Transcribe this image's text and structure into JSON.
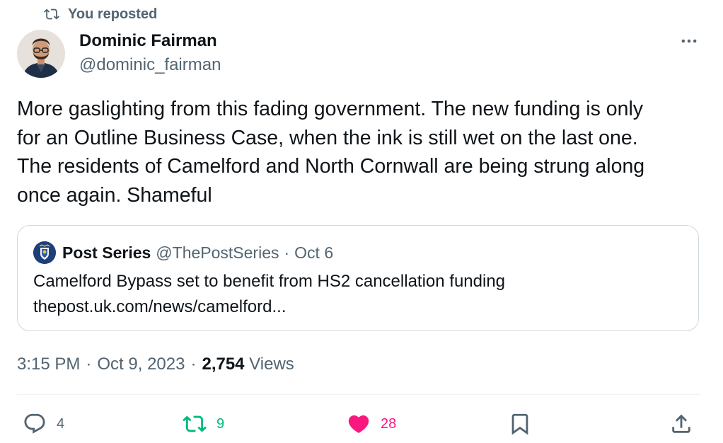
{
  "repost_banner": {
    "label": "You reposted"
  },
  "author": {
    "name": "Dominic Fairman",
    "handle": "@dominic_fairman"
  },
  "tweet": {
    "text": "More gaslighting from this fading government. The new funding is only\nfor an Outline Business Case, when the ink is still wet on the last one.\nThe residents of Camelford and North Cornwall are being strung along\nonce again. Shameful"
  },
  "quote": {
    "name": "Post Series",
    "handle": "@ThePostSeries",
    "separator": "·",
    "date": "Oct 6",
    "title": "Camelford Bypass set to benefit from HS2 cancellation funding",
    "link": "thepost.uk.com/news/camelford..."
  },
  "meta": {
    "time": "3:15 PM",
    "dot1": "·",
    "date": "Oct 9, 2023",
    "dot2": "·",
    "views_count": "2,754",
    "views_label": "Views"
  },
  "actions": {
    "replies": "4",
    "reposts": "9",
    "likes": "28"
  },
  "colors": {
    "repost_green": "#00ba7c",
    "like_pink": "#f91880",
    "secondary_text": "#536471",
    "primary_text": "#0f1419"
  },
  "icons": {
    "repost_banner": "repost-icon",
    "more": "more-dots-icon",
    "reply": "reply-bubble-icon",
    "repost": "repost-icon",
    "like": "heart-filled-icon",
    "bookmark": "bookmark-icon",
    "share": "share-upload-icon"
  }
}
